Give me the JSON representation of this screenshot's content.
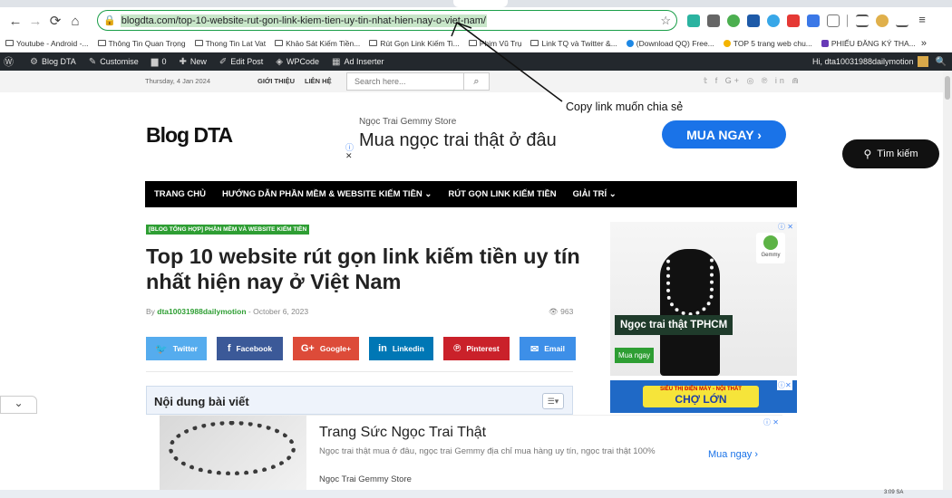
{
  "browser": {
    "url": "blogdta.com/top-10-website-rut-gon-link-kiem-tien-uy-tin-nhat-hien-nay-o-viet-nam/",
    "bookmarks": [
      "Youtube - Android -...",
      "Thông Tin Quan Trọng",
      "Thong Tin Lat Vat",
      "Khảo Sát Kiếm Tiền...",
      "Rút Gọn Link Kiếm Ti...",
      "Phim Vũ Trụ",
      "Link TQ và Twitter &...",
      "(Download QQ) Free...",
      "TOP 5 trang web chu...",
      "PHIẾU ĐĂNG KÝ THA..."
    ],
    "more_bookmarks": "»"
  },
  "adminbar": {
    "site": "Blog DTA",
    "customise": "Customise",
    "comments": "0",
    "new": "New",
    "edit": "Edit Post",
    "wpcode": "WPCode",
    "adinserter": "Ad Inserter",
    "greeting": "Hi, dta10031988dailymotion"
  },
  "site": {
    "date": "Thursday, 4 Jan 2024",
    "top_nav": [
      "GIỚI THIỆU",
      "LIÊN HỆ"
    ],
    "search_placeholder": "Search here...",
    "logo": "Blog DTA",
    "find_button": "Tìm kiếm",
    "main_nav": [
      "TRANG CHỦ",
      "HƯỚNG DẪN PHẦN MỀM & WEBSITE KIẾM TIỀN ⌄",
      "RÚT GỌN LINK KIẾM TIỀN",
      "GIẢI TRÍ ⌄"
    ]
  },
  "header_ad": {
    "store": "Ngọc Trai Gemmy Store",
    "headline": "Mua ngọc trai thật ở đâu",
    "cta": "MUA NGAY  ›"
  },
  "article": {
    "category": "[BLOG TỔNG HỢP] PHẦN MỀM VÀ WEBSITE KIẾM TIỀN",
    "title": "Top 10 website rút gọn link kiếm tiền uy tín nhất hiện nay ở Việt Nam",
    "by": "By ",
    "author": "dta10031988dailymotion",
    "date_sep": " - October 6, 2023",
    "views": "963",
    "shares": [
      {
        "label": "Twitter",
        "icon": "twitter-icon",
        "color": "#55acee"
      },
      {
        "label": "Facebook",
        "icon": "facebook-icon",
        "color": "#3b5998"
      },
      {
        "label": "Google+",
        "icon": "googleplus-icon",
        "color": "#dd4b39"
      },
      {
        "label": "Linkedin",
        "icon": "linkedin-icon",
        "color": "#0077b5"
      },
      {
        "label": "Pinterest",
        "icon": "pinterest-icon",
        "color": "#ca212a"
      },
      {
        "label": "Email",
        "icon": "email-icon",
        "color": "#3d8fe8"
      }
    ],
    "toc_title": "Nội dung bài viết"
  },
  "side_ad": {
    "caption": "Ngọc trai thật TPHCM",
    "buy": "Mua ngay",
    "brand": "Gemmy",
    "banner_top": "SIÊU THỊ ĐIỆN MÁY - NỘI THẤT",
    "banner_main": "CHỢ LỚN"
  },
  "bottom_ad": {
    "headline": "Trang Sức Ngọc Trai Thật",
    "desc": "Ngọc trai thật mua ở đâu, ngọc trai Gemmy địa chỉ mua hàng uy tín, ngọc trai thật 100%",
    "source": "Ngọc Trai Gemmy Store",
    "cta": "Mua ngay  ›"
  },
  "annotation": "Copy link muốn chia sẻ",
  "taskbar_time": "3:09 SA",
  "colors": {
    "accent_green": "#2e9e33",
    "nav_black": "#000000",
    "ad_blue": "#1a73e8",
    "omnibox_border": "#1a9e48"
  }
}
